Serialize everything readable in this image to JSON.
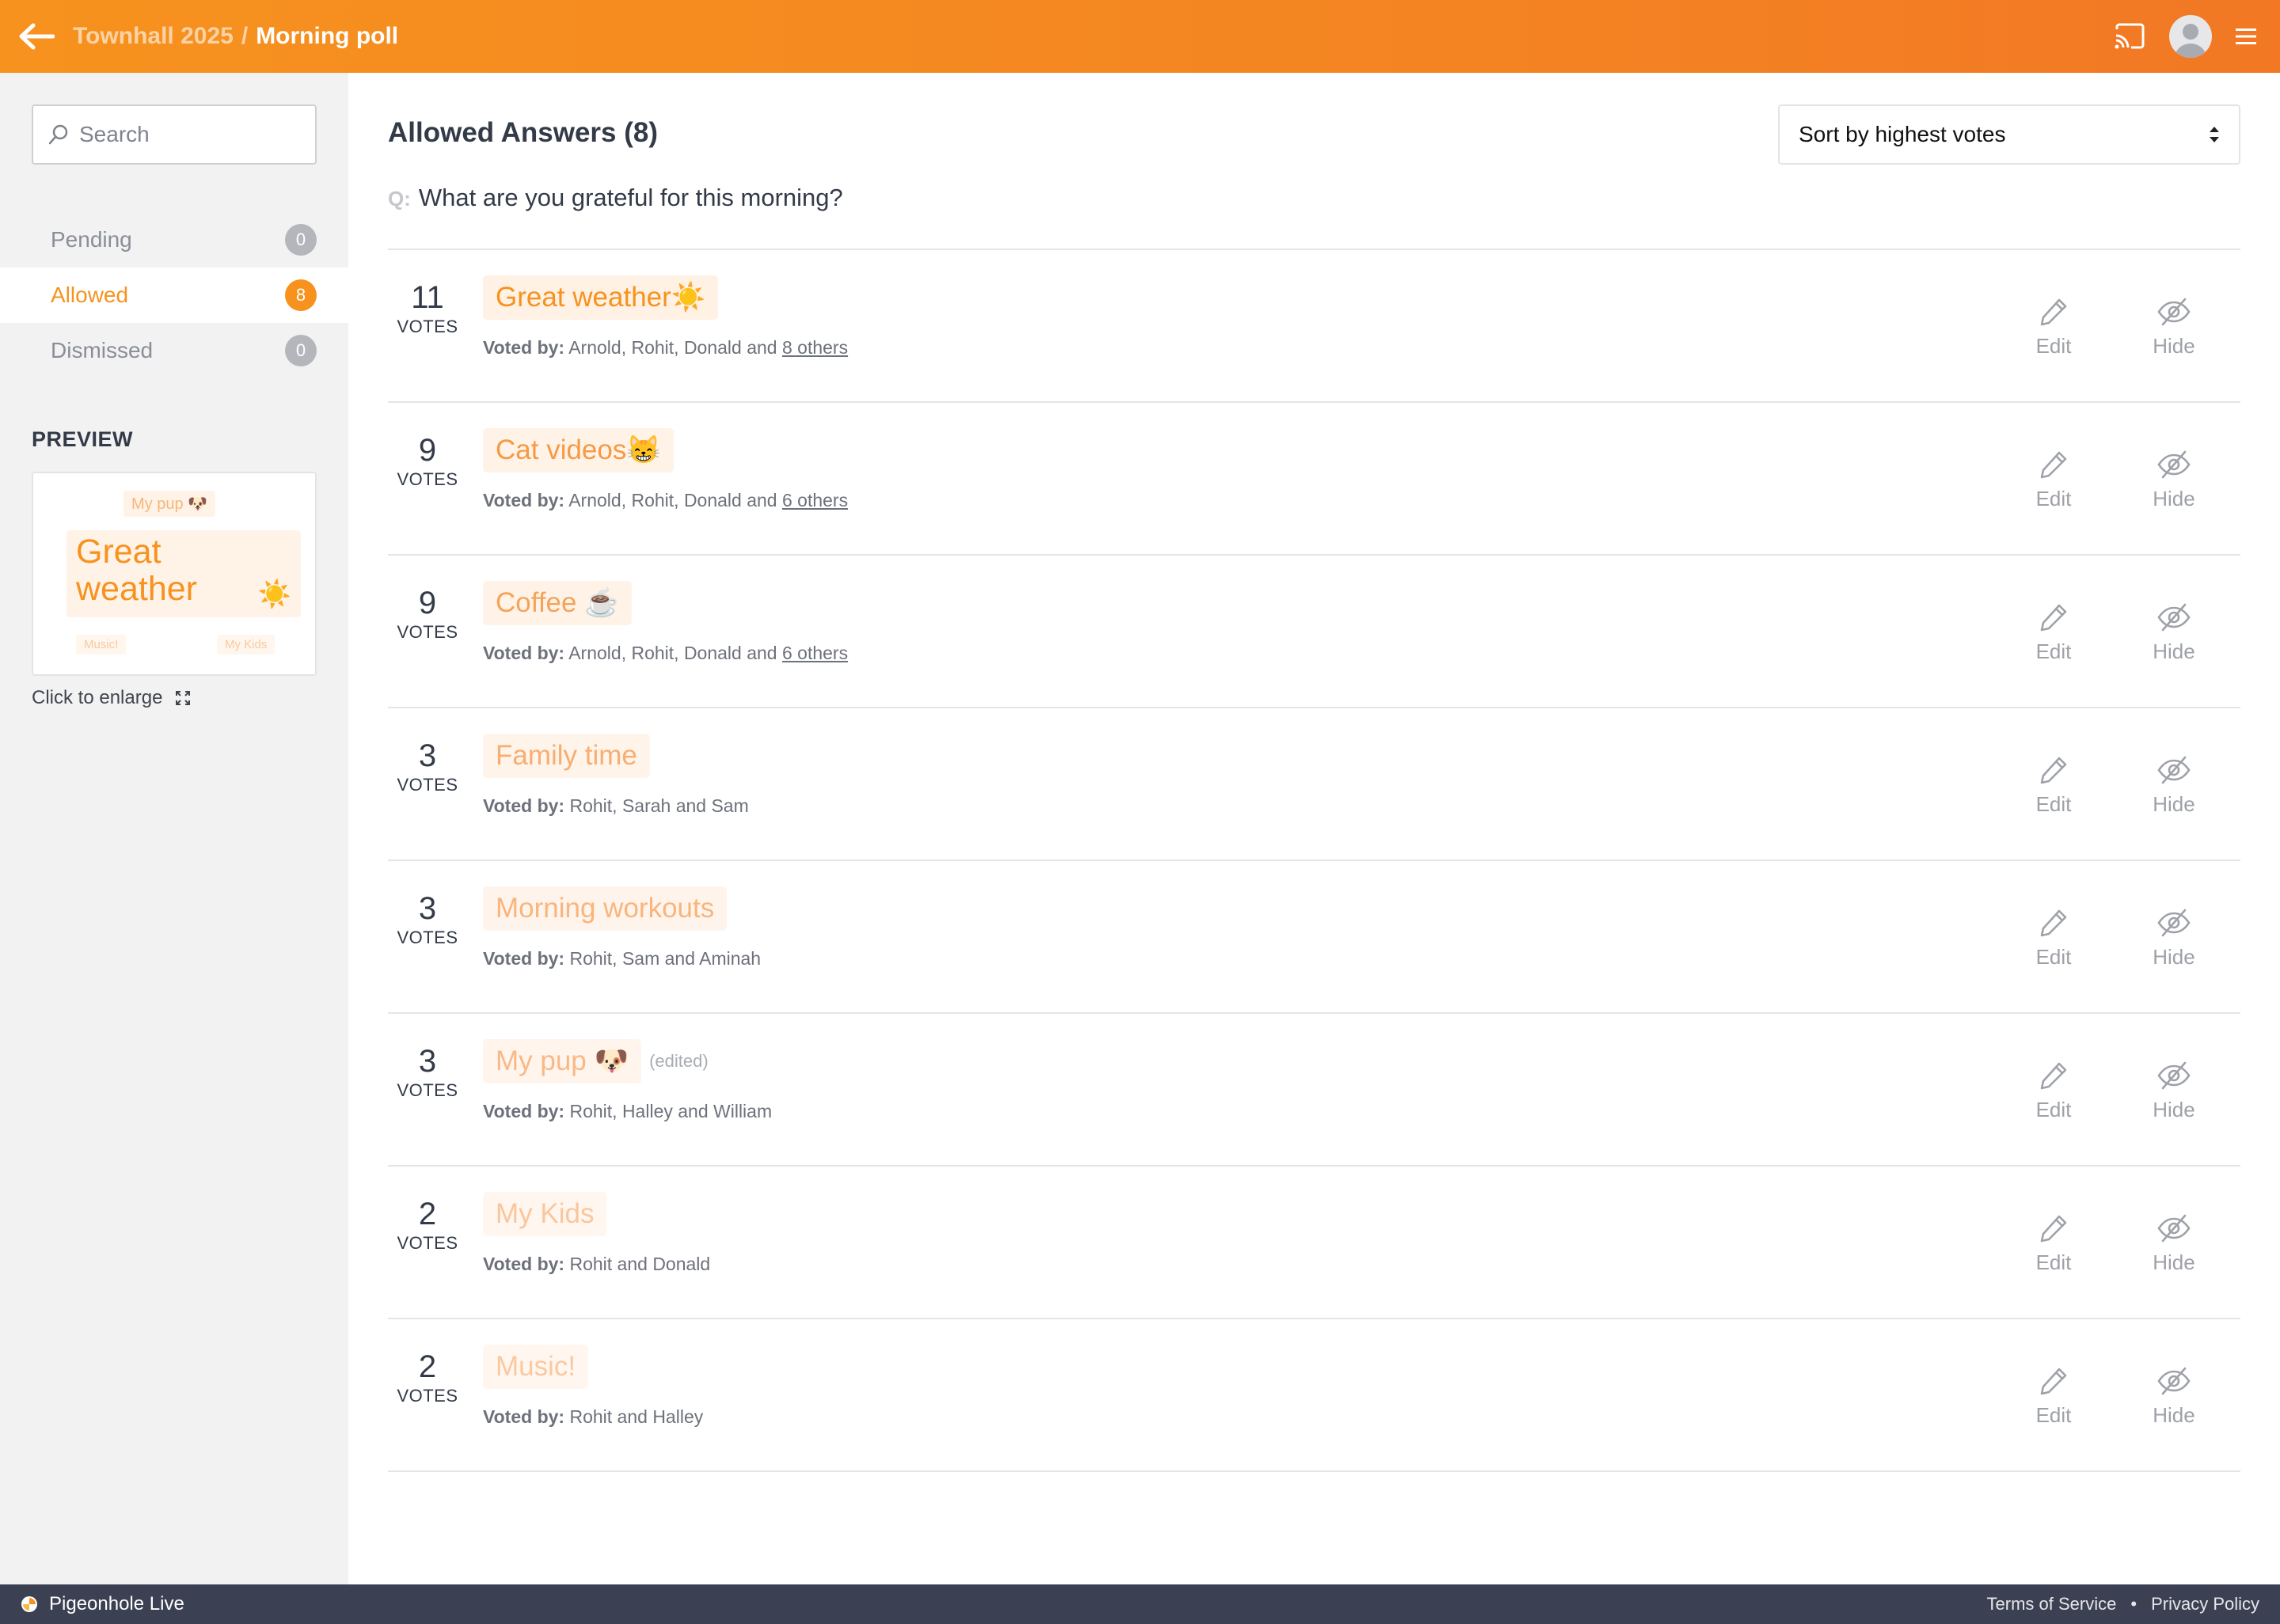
{
  "header": {
    "parent": "Townhall 2025",
    "separator": "/",
    "current": "Morning poll"
  },
  "sidebar": {
    "search_placeholder": "Search",
    "nav": [
      {
        "label": "Pending",
        "count": "0"
      },
      {
        "label": "Allowed",
        "count": "8"
      },
      {
        "label": "Dismissed",
        "count": "0"
      }
    ],
    "preview_title": "PREVIEW",
    "preview": {
      "pup": "My pup 🐶",
      "main": "Great weather",
      "main_emoji": "☀️",
      "music": "Music!",
      "kids": "My Kids"
    },
    "enlarge": "Click to enlarge"
  },
  "main": {
    "heading": "Allowed Answers (8)",
    "sort_label": "Sort by highest votes",
    "question_prefix": "Q:",
    "question": "What are you grateful for this morning?",
    "votes_label": "VOTES",
    "voted_by_label": "Voted by:",
    "edit_label": "Edit",
    "hide_label": "Hide",
    "answers": [
      {
        "votes": "11",
        "text": "Great weather☀️",
        "voters": "Arnold, Rohit, Donald and ",
        "others": "8 others",
        "edited": ""
      },
      {
        "votes": "9",
        "text": "Cat videos😸",
        "voters": "Arnold, Rohit, Donald and ",
        "others": "6 others",
        "edited": ""
      },
      {
        "votes": "9",
        "text": "Coffee ☕",
        "voters": "Arnold, Rohit, Donald and ",
        "others": "6 others",
        "edited": ""
      },
      {
        "votes": "3",
        "text": "Family time",
        "voters": "Rohit, Sarah and Sam",
        "others": "",
        "edited": ""
      },
      {
        "votes": "3",
        "text": "Morning workouts",
        "voters": "Rohit, Sam and Aminah",
        "others": "",
        "edited": ""
      },
      {
        "votes": "3",
        "text": "My pup 🐶",
        "voters": "Rohit, Halley and William",
        "others": "",
        "edited": "(edited)"
      },
      {
        "votes": "2",
        "text": "My Kids",
        "voters": "Rohit and Donald",
        "others": "",
        "edited": ""
      },
      {
        "votes": "2",
        "text": "Music!",
        "voters": "Rohit and Halley",
        "others": "",
        "edited": ""
      }
    ]
  },
  "footer": {
    "brand": "Pigeonhole Live",
    "terms": "Terms of Service",
    "dot": "•",
    "privacy": "Privacy Policy"
  },
  "colors": {
    "accent": "#f7921e",
    "footer_bg": "#3b4152",
    "sidebar_bg": "#f2f2f3",
    "answer_shades": [
      "#f7921e",
      "#f59a45",
      "#f6a35a",
      "#f8ad72",
      "#f8b57d",
      "#f9b987",
      "#fbc69b",
      "#fbc99f"
    ],
    "answer_bgs": [
      "#fff1e4",
      "#fff2e6",
      "#fff3e8",
      "#fff4ea",
      "#fff4ec",
      "#fff5ed",
      "#fff6ef",
      "#fff6f0"
    ]
  }
}
